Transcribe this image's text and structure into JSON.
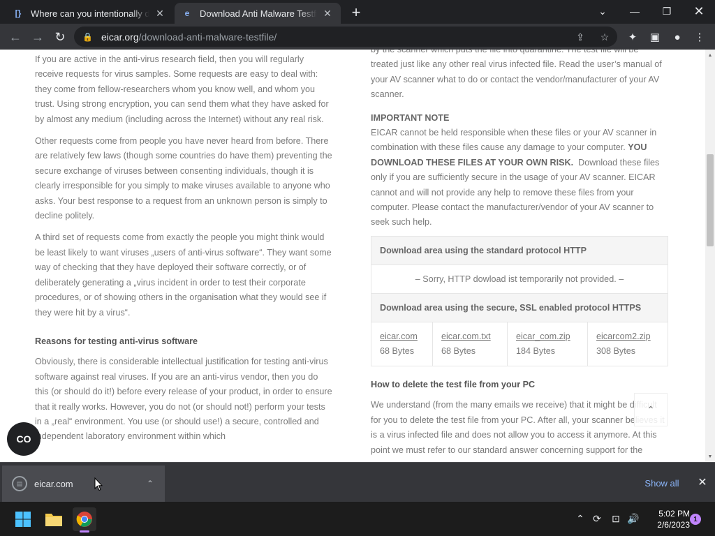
{
  "browser": {
    "tabs": [
      {
        "title": "Where can you intentionally dow",
        "favicon": "bracket-icon"
      },
      {
        "title": "Download Anti Malware Testfile -",
        "favicon": "edge-icon"
      }
    ],
    "url_host": "eicar.org",
    "url_path": "/download-anti-malware-testfile/"
  },
  "left_column": {
    "p1": "If you are active in the anti-virus research field, then you will regularly receive requests for virus samples. Some requests are easy to deal with: they come from fellow-researchers whom you know well, and whom you trust. Using strong encryption, you can send them what they have asked for by almost any medium (including across the Internet) without any real risk.",
    "p2": "Other requests come from people you have never heard from before. There are relatively few laws (though some countries do have them) preventing the secure exchange of viruses between consenting individuals, though it is clearly irresponsible for you simply to make viruses available to anyone who asks. Your best response to a request from an unknown person is simply to decline politely.",
    "p3": "A third set of requests come from exactly the people you might think would be least likely to want viruses „users of anti-virus software“. They want some way of checking that they have deployed their software correctly, or of deliberately generating a „virus incident in order to test their corporate procedures, or of showing others in the organisation what they would see if they were hit by a virus“.",
    "heading": "Reasons for testing anti-virus software",
    "p4": "Obviously, there is considerable intellectual justification for testing anti-virus software against real viruses. If you are an anti-virus vendor, then you do this (or should do it!) before every release of your product, in order to ensure that it really works. However, you do not (or should not!) perform your tests in a „real“ environment. You use (or should use!) a secure, controlled and independent laboratory environment within which"
  },
  "right_column": {
    "p0": "by the scanner which puts the file into quarantine. The test file will be treated just like any other real virus infected file. Read the user’s manual of your AV scanner what to do or contact the vendor/manufacturer of your AV scanner.",
    "note_heading": "IMPORTANT NOTE",
    "note_a": "EICAR cannot be held responsible when these files or your AV scanner in combination with these files cause any damage to your computer.",
    "note_b": "YOU DOWNLOAD THESE FILES AT YOUR OWN RISK.",
    "note_c": "Download these files only if you are sufficiently secure in the usage of your AV scanner. EICAR cannot and will not provide any help to remove these files from your computer. Please contact the manufacturer/vendor of your AV scanner to seek such help.",
    "delete_heading": "How to delete the test file from your PC",
    "delete_text": "We understand (from the many emails we receive) that it might be difficult for you to delete the test file from your PC. After all, your scanner believes it is a virus infected file and does not allow you to access it anymore. At this point we must refer to our standard answer concerning support for the"
  },
  "download_table": {
    "http_heading": "Download area using the standard protocol HTTP",
    "http_sorry": "– Sorry, HTTP dowload ist temporarily not provided. –",
    "https_heading": "Download area using the secure, SSL enabled protocol HTTPS",
    "files": [
      {
        "name": "eicar.com",
        "size": "68 Bytes"
      },
      {
        "name": "eicar.com.txt",
        "size": "68 Bytes"
      },
      {
        "name": "eicar_com.zip",
        "size": "184 Bytes"
      },
      {
        "name": "eicarcom2.zip",
        "size": "308 Bytes"
      }
    ]
  },
  "cc_fab": "CO",
  "download_bar": {
    "item": "eicar.com",
    "show_all": "Show all"
  },
  "taskbar": {
    "time": "5:02 PM",
    "date": "2/6/2023",
    "notification_count": "1"
  }
}
